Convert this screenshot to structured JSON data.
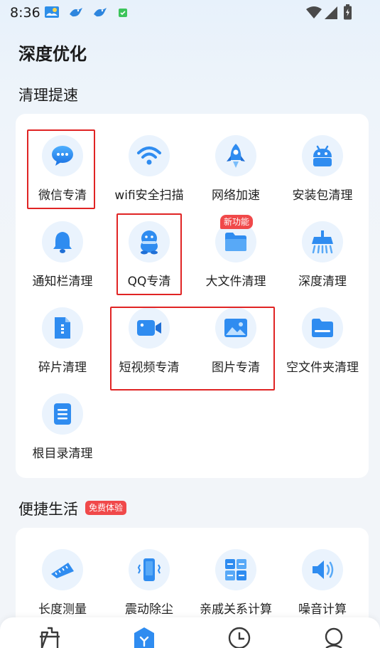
{
  "status_bar": {
    "time": "8:36",
    "icons": [
      "weather-icon",
      "bird-notification-icon",
      "bird-notification-icon",
      "app-notification-icon",
      "wifi-icon",
      "signal-icon",
      "battery-icon"
    ]
  },
  "page_title": "深度优化",
  "cleanup_section": {
    "title": "清理提速",
    "items": [
      {
        "label": "微信专清",
        "icon": "wechat-icon"
      },
      {
        "label": "wifi安全扫描",
        "icon": "wifi-icon"
      },
      {
        "label": "网络加速",
        "icon": "rocket-icon"
      },
      {
        "label": "安装包清理",
        "icon": "android-icon"
      },
      {
        "label": "通知栏清理",
        "icon": "bell-icon"
      },
      {
        "label": "QQ专清",
        "icon": "qq-icon"
      },
      {
        "label": "大文件清理",
        "icon": "folder-icon",
        "badge": "新功能"
      },
      {
        "label": "深度清理",
        "icon": "deep-clean-icon"
      },
      {
        "label": "碎片清理",
        "icon": "fragment-file-icon"
      },
      {
        "label": "短视频专清",
        "icon": "video-camera-icon"
      },
      {
        "label": "图片专清",
        "icon": "image-icon"
      },
      {
        "label": "空文件夹清理",
        "icon": "empty-folder-icon"
      },
      {
        "label": "根目录清理",
        "icon": "root-list-icon"
      }
    ]
  },
  "life_section": {
    "title": "便捷生活",
    "badge": "免费体验",
    "items": [
      {
        "label": "长度测量",
        "icon": "ruler-icon"
      },
      {
        "label": "震动除尘",
        "icon": "vibrate-phone-icon"
      },
      {
        "label": "亲戚关系计算",
        "icon": "relatives-calculator-icon"
      },
      {
        "label": "噪音计算",
        "icon": "speaker-icon"
      }
    ]
  },
  "bottom_nav": [
    "clean-tab-icon",
    "optimize-tab-icon",
    "history-tab-icon",
    "profile-tab-icon"
  ],
  "colors": {
    "accent": "#2f8cf0",
    "icon_bg": "#eaf3fd",
    "badge": "#f0494a",
    "highlight": "#e02424"
  }
}
